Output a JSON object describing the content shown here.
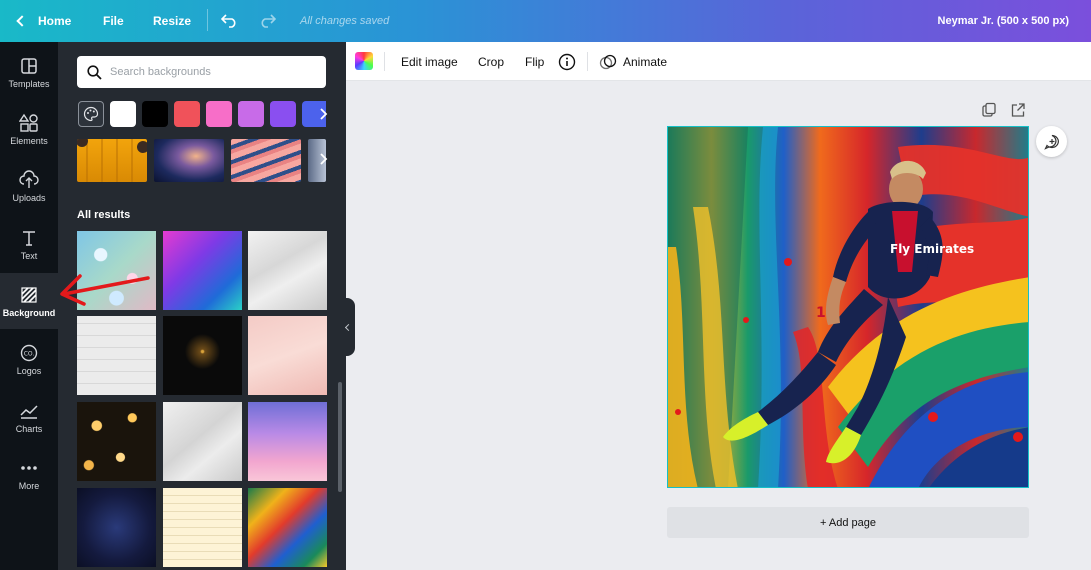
{
  "topbar": {
    "home_label": "Home",
    "file_label": "File",
    "resize_label": "Resize",
    "save_status": "All changes saved",
    "document_title": "Neymar Jr. (500 x 500 px)"
  },
  "rail": {
    "items": [
      {
        "label": "Templates",
        "icon": "templates-icon"
      },
      {
        "label": "Elements",
        "icon": "elements-icon"
      },
      {
        "label": "Uploads",
        "icon": "upload-icon"
      },
      {
        "label": "Text",
        "icon": "text-icon"
      },
      {
        "label": "Background",
        "icon": "background-icon",
        "active": true
      },
      {
        "label": "Logos",
        "icon": "logo-icon"
      },
      {
        "label": "Charts",
        "icon": "chart-icon"
      },
      {
        "label": "More",
        "icon": "more-icon"
      }
    ]
  },
  "panel": {
    "search_placeholder": "Search backgrounds",
    "swatches": [
      "#ffffff",
      "#000000",
      "#f0525a",
      "#f76ec8",
      "#c86be8",
      "#8a4ff0",
      "#4c62ec"
    ],
    "section_title": "All results"
  },
  "toolbar": {
    "edit_image": "Edit image",
    "crop": "Crop",
    "flip": "Flip",
    "animate": "Animate"
  },
  "canvas": {
    "add_page_label": "+ Add page",
    "jersey_text": "Fly Emirates",
    "jersey_number": "10"
  },
  "colors": {
    "accent": "#15c0c8",
    "panel_bg": "#252a31",
    "rail_bg": "#0e1318",
    "annotation_arrow": "#e3191b"
  }
}
